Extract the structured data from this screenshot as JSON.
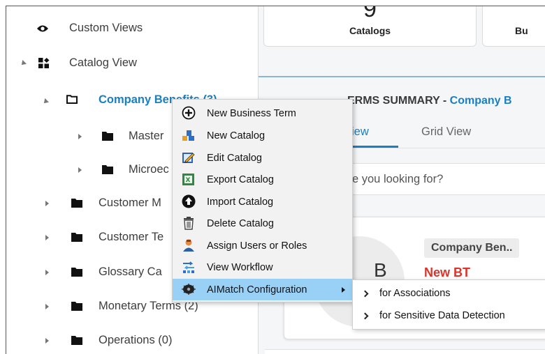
{
  "tree": {
    "items": [
      {
        "label": "Custom Views",
        "icon": "eye-icon"
      },
      {
        "label": "Catalog View",
        "icon": "catalog-view-icon"
      },
      {
        "label": "Company Benefits (3)",
        "icon": "folder-outline-icon"
      },
      {
        "label": "Master",
        "icon": "folder-icon"
      },
      {
        "label": "Microec",
        "icon": "folder-icon"
      },
      {
        "label": "Customer M",
        "icon": "folder-icon"
      },
      {
        "label": "Customer Te",
        "icon": "folder-icon"
      },
      {
        "label": "Glossary Ca",
        "icon": "folder-icon"
      },
      {
        "label": "Monetary Terms (2)",
        "icon": "folder-icon"
      },
      {
        "label": "Operations (0)",
        "icon": "folder-icon"
      }
    ]
  },
  "dashboard": {
    "catalogs_count": "9",
    "catalogs_label": "Catalogs",
    "second_card_label": "Bu",
    "summary_prefix": "ERMS SUMMARY - ",
    "summary_accent": "Company B"
  },
  "tabs": {
    "list_view": "iew",
    "grid_view": "Grid View"
  },
  "search": {
    "placeholder": "e you looking for?"
  },
  "term_card": {
    "avatar_letter": "B",
    "chip": "Company Ben..",
    "name": "New BT"
  },
  "context_menu": {
    "items": [
      {
        "label": "New Business Term",
        "icon": "plus-circle-icon"
      },
      {
        "label": "New Catalog",
        "icon": "new-catalog-icon"
      },
      {
        "label": "Edit Catalog",
        "icon": "edit-catalog-icon"
      },
      {
        "label": "Export Catalog",
        "icon": "export-icon"
      },
      {
        "label": "Import Catalog",
        "icon": "import-icon"
      },
      {
        "label": "Delete Catalog",
        "icon": "trash-icon"
      },
      {
        "label": "Assign Users or Roles",
        "icon": "assign-users-icon"
      },
      {
        "label": "View Workflow",
        "icon": "workflow-icon"
      },
      {
        "label": "AIMatch Configuration",
        "icon": "aimatch-icon"
      }
    ],
    "highlighted": "AIMatch Configuration"
  },
  "submenu": {
    "items": [
      {
        "label": "for Associations"
      },
      {
        "label": "for Sensitive Data Detection"
      }
    ]
  },
  "colors": {
    "accent": "#1a7fc1",
    "highlight": "#99d0f5",
    "term_name": "#d9352b"
  }
}
